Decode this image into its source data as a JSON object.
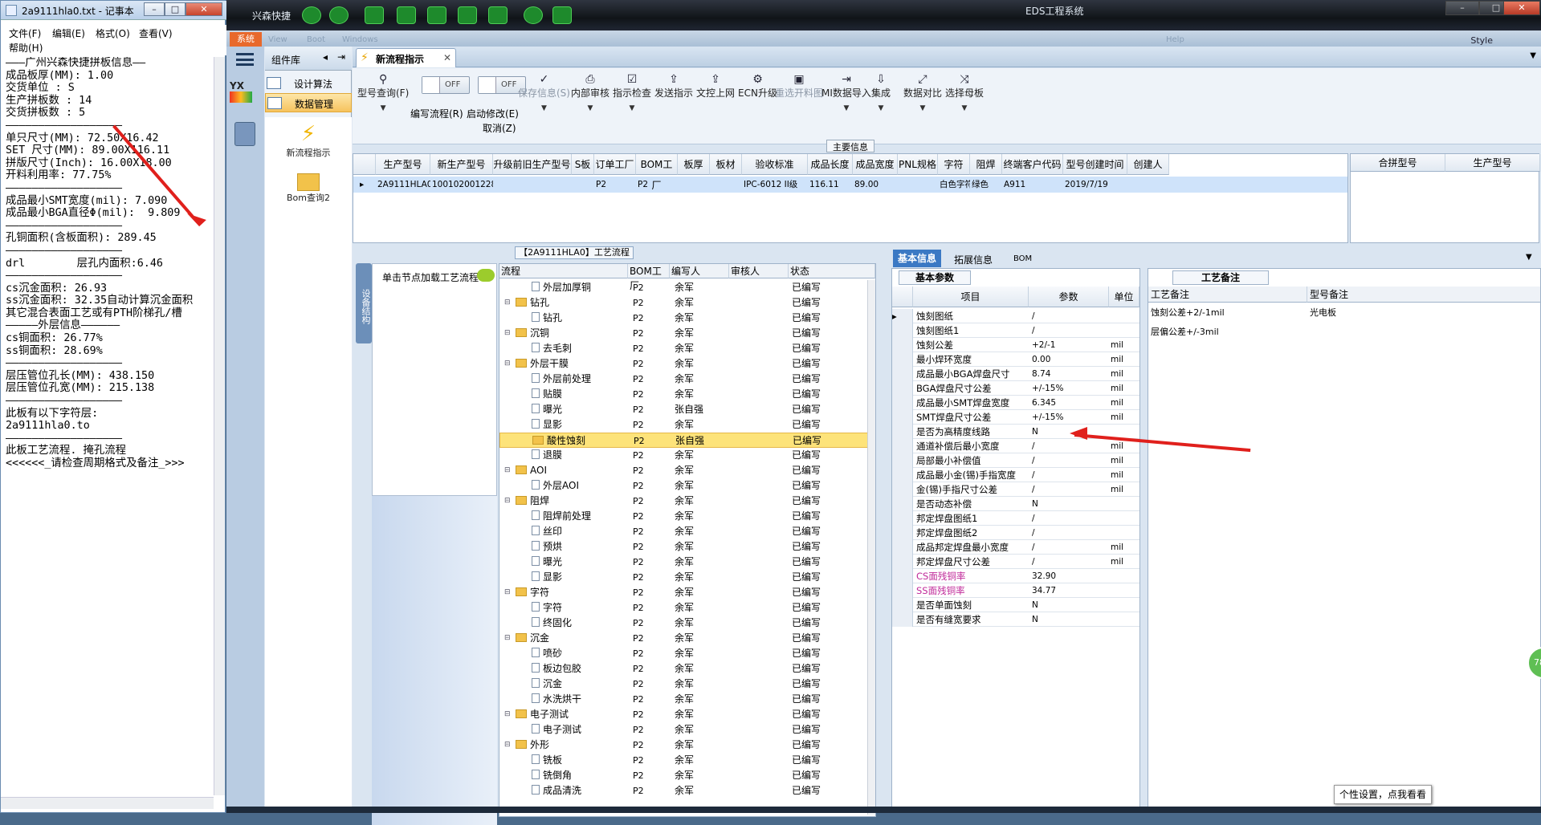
{
  "notepad": {
    "title": "2a9111hla0.txt - 记事本",
    "menu": {
      "file": "文件(F)",
      "edit": "编辑(E)",
      "format": "格式(O)",
      "view": "查看(V)",
      "help": "帮助(H)"
    },
    "lines": [
      "———广州兴森快捷拼板信息——",
      "成品板厚(MM): 1.00",
      "交货单位 : S",
      "生产拼板数 : 14",
      "交货拼板数 : 5",
      "——————————————————",
      "单只尺寸(MM): 72.50X16.42",
      "SET 尺寸(MM): 89.00X116.11",
      "拼版尺寸(Inch): 16.00X18.00",
      "开料利用率: 77.75%",
      "——————————————————",
      "成品最小SMT宽度(mil): 7.090",
      "成品最小BGA直径Φ(mil):  9.809",
      "——————————————————",
      "孔铜面积(含板面积): 289.45",
      "",
      "——————————————————",
      "drl        层孔内面积:6.46",
      "——————————————————",
      "",
      "cs沉金面积: 26.93",
      "ss沉金面积: 32.35自动计算沉金面积",
      "其它混合表面工艺或有PTH阶梯孔/槽",
      "—————外层信息——————",
      "cs铜面积: 26.77%",
      "ss铜面积: 28.69%",
      "——————————————————",
      "层压管位孔长(MM): 438.150",
      "层压管位孔宽(MM): 215.138",
      "——————————————————",
      "",
      "此板有以下字符层:",
      "2a9111hla0.to",
      "——————————————————",
      "此板工艺流程. 掩孔流程",
      "<<<<<<_请检查周期格式及备注_>>>"
    ]
  },
  "app": {
    "name": "兴森快捷",
    "title": "EDS工程系统",
    "system_tab": "系统",
    "style_label": "Style",
    "ribbon_ghost": [
      "View",
      "Boot",
      "Windows",
      "Help"
    ],
    "component_panel": {
      "title": "组件库",
      "items": [
        "设计算法",
        "数据管理"
      ],
      "icons": [
        "新流程指示",
        "Bom查询2"
      ]
    },
    "tab": {
      "label": "新流程指示"
    },
    "toolbar": [
      {
        "label": "型号查询(F)",
        "icon": "⚲",
        "dd": true,
        "disabled": false
      },
      {
        "label": "编写流程(R)",
        "toggle": "OFF"
      },
      {
        "label": "启动修改(E)",
        "toggle": "OFF",
        "sub": "取消(Z)"
      },
      {
        "label": "保存信息(S)",
        "icon": "✓",
        "dd": true,
        "disabled": true
      },
      {
        "label": "内部审核",
        "icon": "⎙",
        "dd": true,
        "disabled": false
      },
      {
        "label": "指示检查",
        "icon": "☑",
        "dd": true,
        "disabled": false
      },
      {
        "label": "发送指示",
        "icon": "⇪",
        "disabled": false
      },
      {
        "label": "文控上网",
        "icon": "⇪",
        "disabled": false
      },
      {
        "label": "ECN升级",
        "icon": "⚙",
        "disabled": false
      },
      {
        "label": "重选开料图",
        "icon": "▣",
        "disabled": true
      },
      {
        "label": "MI数据导入",
        "icon": "⇥",
        "dd": true,
        "disabled": false
      },
      {
        "label": "集成",
        "icon": "⇩",
        "dd": true,
        "disabled": false
      },
      {
        "label": "数据对比",
        "icon": "⤢",
        "dd": true,
        "disabled": false
      },
      {
        "label": "选择母板",
        "icon": "⤨",
        "dd": true,
        "disabled": false
      }
    ],
    "main_info": {
      "title": "主要信息",
      "columns": [
        "生产型号",
        "新生产型号",
        "升级前旧生产型号",
        "S板",
        "订单工厂",
        "BOM工厂",
        "板厚",
        "板材",
        "验收标准",
        "成品长度",
        "成品宽度",
        "PNL规格",
        "字符",
        "阻焊",
        "终端客户代码",
        "型号创建时间",
        "创建人"
      ],
      "row": [
        "2A9111HLA0",
        "10010200122885",
        "",
        "",
        "P2",
        "P2",
        "",
        "",
        "IPC-6012 II级",
        "116.11",
        "89.00",
        "",
        "白色字符",
        "绿色",
        "A911",
        "2019/7/19",
        ""
      ],
      "side_columns": [
        "合拼型号",
        "生产型号"
      ]
    },
    "process": {
      "title": "【2A9111HLA0】工艺流程",
      "vertical_tab": "设备结构",
      "node_hint": "单击节点加载工艺流程",
      "columns": [
        "流程",
        "BOM工厂",
        "编写人",
        "审核人",
        "状态"
      ],
      "rows": [
        {
          "level": 1,
          "type": "doc",
          "name": "外层加厚铜",
          "bom": "P2",
          "writer": "余军",
          "status": "已编写"
        },
        {
          "level": 0,
          "type": "folder",
          "name": "钻孔",
          "bom": "P2",
          "writer": "余军",
          "status": "已编写"
        },
        {
          "level": 1,
          "type": "doc",
          "name": "钻孔",
          "bom": "P2",
          "writer": "余军",
          "status": "已编写"
        },
        {
          "level": 0,
          "type": "folder",
          "name": "沉铜",
          "bom": "P2",
          "writer": "余军",
          "status": "已编写"
        },
        {
          "level": 1,
          "type": "doc",
          "name": "去毛刺",
          "bom": "P2",
          "writer": "余军",
          "status": "已编写"
        },
        {
          "level": 0,
          "type": "folder",
          "name": "外层干膜",
          "bom": "P2",
          "writer": "余军",
          "status": "已编写"
        },
        {
          "level": 1,
          "type": "doc",
          "name": "外层前处理",
          "bom": "P2",
          "writer": "余军",
          "status": "已编写"
        },
        {
          "level": 1,
          "type": "doc",
          "name": "贴膜",
          "bom": "P2",
          "writer": "余军",
          "status": "已编写"
        },
        {
          "level": 1,
          "type": "doc",
          "name": "曝光",
          "bom": "P2",
          "writer": "张自强",
          "status": "已编写"
        },
        {
          "level": 1,
          "type": "doc",
          "name": "显影",
          "bom": "P2",
          "writer": "余军",
          "status": "已编写"
        },
        {
          "level": 1,
          "type": "folder",
          "name": "酸性蚀刻",
          "bom": "P2",
          "writer": "张自强",
          "status": "已编写",
          "selected": true
        },
        {
          "level": 1,
          "type": "doc",
          "name": "退膜",
          "bom": "P2",
          "writer": "余军",
          "status": "已编写"
        },
        {
          "level": 0,
          "type": "folder",
          "name": "AOI",
          "bom": "P2",
          "writer": "余军",
          "status": "已编写"
        },
        {
          "level": 1,
          "type": "doc",
          "name": "外层AOI",
          "bom": "P2",
          "writer": "余军",
          "status": "已编写"
        },
        {
          "level": 0,
          "type": "folder",
          "name": "阻焊",
          "bom": "P2",
          "writer": "余军",
          "status": "已编写"
        },
        {
          "level": 1,
          "type": "doc",
          "name": "阻焊前处理",
          "bom": "P2",
          "writer": "余军",
          "status": "已编写"
        },
        {
          "level": 1,
          "type": "doc",
          "name": "丝印",
          "bom": "P2",
          "writer": "余军",
          "status": "已编写"
        },
        {
          "level": 1,
          "type": "doc",
          "name": "预烘",
          "bom": "P2",
          "writer": "余军",
          "status": "已编写"
        },
        {
          "level": 1,
          "type": "doc",
          "name": "曝光",
          "bom": "P2",
          "writer": "余军",
          "status": "已编写"
        },
        {
          "level": 1,
          "type": "doc",
          "name": "显影",
          "bom": "P2",
          "writer": "余军",
          "status": "已编写"
        },
        {
          "level": 0,
          "type": "folder",
          "name": "字符",
          "bom": "P2",
          "writer": "余军",
          "status": "已编写"
        },
        {
          "level": 1,
          "type": "doc",
          "name": "字符",
          "bom": "P2",
          "writer": "余军",
          "status": "已编写"
        },
        {
          "level": 1,
          "type": "doc",
          "name": "终固化",
          "bom": "P2",
          "writer": "余军",
          "status": "已编写"
        },
        {
          "level": 0,
          "type": "folder",
          "name": "沉金",
          "bom": "P2",
          "writer": "余军",
          "status": "已编写"
        },
        {
          "level": 1,
          "type": "doc",
          "name": "喷砂",
          "bom": "P2",
          "writer": "余军",
          "status": "已编写"
        },
        {
          "level": 1,
          "type": "doc",
          "name": "板边包胶",
          "bom": "P2",
          "writer": "余军",
          "status": "已编写"
        },
        {
          "level": 1,
          "type": "doc",
          "name": "沉金",
          "bom": "P2",
          "writer": "余军",
          "status": "已编写"
        },
        {
          "level": 1,
          "type": "doc",
          "name": "水洗烘干",
          "bom": "P2",
          "writer": "余军",
          "status": "已编写"
        },
        {
          "level": 0,
          "type": "folder",
          "name": "电子测试",
          "bom": "P2",
          "writer": "余军",
          "status": "已编写"
        },
        {
          "level": 1,
          "type": "doc",
          "name": "电子测试",
          "bom": "P2",
          "writer": "余军",
          "status": "已编写"
        },
        {
          "level": 0,
          "type": "folder",
          "name": "外形",
          "bom": "P2",
          "writer": "余军",
          "status": "已编写"
        },
        {
          "level": 1,
          "type": "doc",
          "name": "铣板",
          "bom": "P2",
          "writer": "余军",
          "status": "已编写"
        },
        {
          "level": 1,
          "type": "doc",
          "name": "铣倒角",
          "bom": "P2",
          "writer": "余军",
          "status": "已编写"
        },
        {
          "level": 1,
          "type": "doc",
          "name": "成品清洗",
          "bom": "P2",
          "writer": "余军",
          "status": "已编写"
        }
      ]
    },
    "right_tabs": [
      "基本信息",
      "拓展信息",
      "BOM"
    ],
    "basic": {
      "title": "基本参数",
      "columns": [
        "项目",
        "参数",
        "单位"
      ],
      "rows": [
        {
          "k": "蚀刻图纸",
          "v": "/",
          "u": ""
        },
        {
          "k": "蚀刻图纸1",
          "v": "/",
          "u": ""
        },
        {
          "k": "蚀刻公差",
          "v": "+2/-1",
          "u": "mil"
        },
        {
          "k": "最小焊环宽度",
          "v": "0.00",
          "u": "mil"
        },
        {
          "k": "成品最小BGA焊盘尺寸",
          "v": "8.74",
          "u": "mil"
        },
        {
          "k": "BGA焊盘尺寸公差",
          "v": "+/-15%",
          "u": "mil"
        },
        {
          "k": "成品最小SMT焊盘宽度",
          "v": "6.345",
          "u": "mil"
        },
        {
          "k": "SMT焊盘尺寸公差",
          "v": "+/-15%",
          "u": "mil"
        },
        {
          "k": "是否为高精度线路",
          "v": "N",
          "u": ""
        },
        {
          "k": "通道补偿后最小宽度",
          "v": "/",
          "u": "mil"
        },
        {
          "k": "局部最小补偿值",
          "v": "/",
          "u": "mil"
        },
        {
          "k": "成品最小金(锡)手指宽度",
          "v": "/",
          "u": "mil"
        },
        {
          "k": "金(锡)手指尺寸公差",
          "v": "/",
          "u": "mil"
        },
        {
          "k": "是否动态补偿",
          "v": "N",
          "u": ""
        },
        {
          "k": "邦定焊盘图纸1",
          "v": "/",
          "u": ""
        },
        {
          "k": "邦定焊盘图纸2",
          "v": "/",
          "u": ""
        },
        {
          "k": "成品邦定焊盘最小宽度",
          "v": "/",
          "u": "mil"
        },
        {
          "k": "邦定焊盘尺寸公差",
          "v": "/",
          "u": "mil"
        },
        {
          "k": "CS面残铜率",
          "v": "32.90",
          "u": "",
          "pink": true
        },
        {
          "k": "SS面残铜率",
          "v": "34.77",
          "u": "",
          "pink": true
        },
        {
          "k": "是否单面蚀刻",
          "v": "N",
          "u": ""
        },
        {
          "k": "是否有缝宽要求",
          "v": "N",
          "u": ""
        }
      ]
    },
    "notes": {
      "title": "工艺备注",
      "columns": [
        "工艺备注",
        "型号备注"
      ],
      "process_notes": [
        "蚀刻公差+2/-1mil",
        "层偏公差+/-3mil"
      ],
      "model_notes": [
        "光电板"
      ]
    },
    "tooltip": "个性设置，点我看看",
    "badge": "78"
  },
  "colors": {
    "arrow": "#e0201c",
    "selected_row": "#fde37a",
    "accent_tab": "#3b79c4"
  }
}
